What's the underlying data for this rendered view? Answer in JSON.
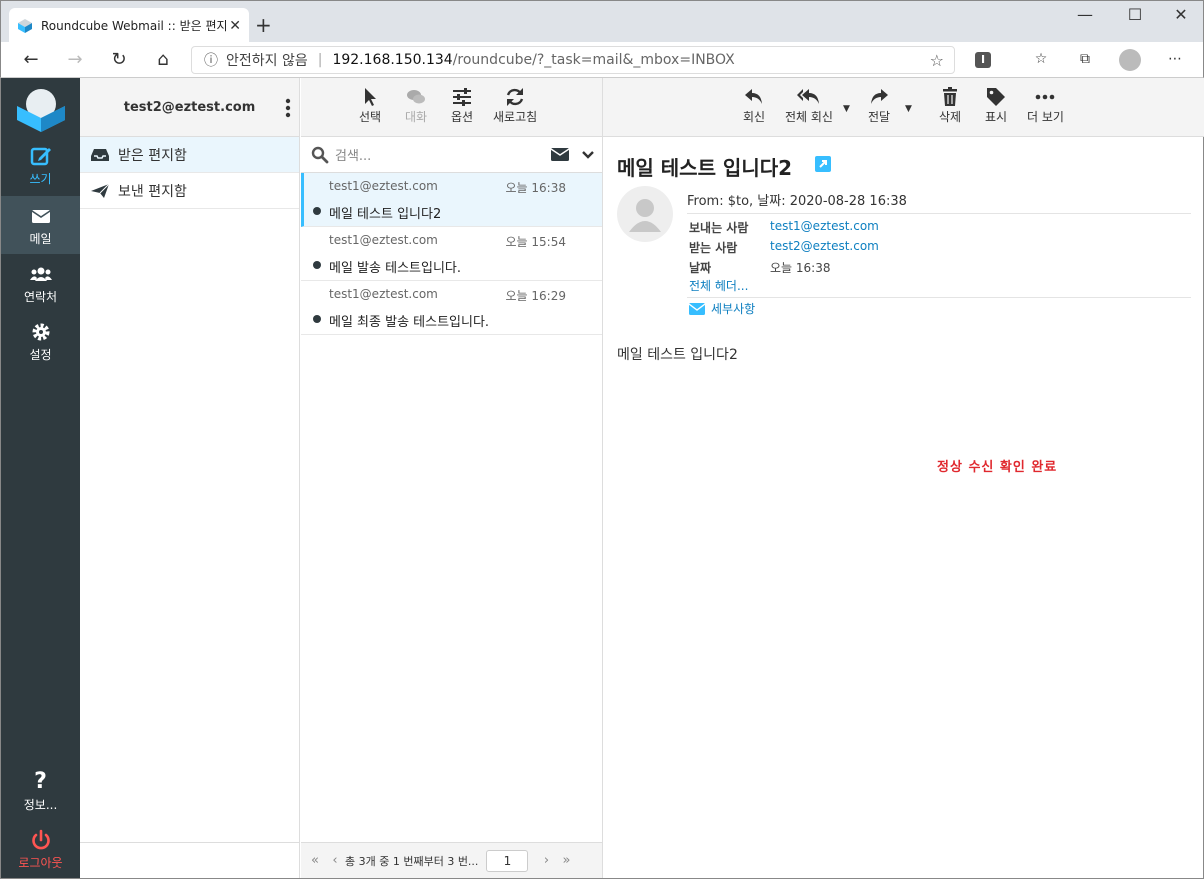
{
  "browser": {
    "tab_title": "Roundcube Webmail :: 받은 편지함",
    "url_warning": "안전하지 않음",
    "url_host": "192.168.150.134",
    "url_path": "/roundcube/?_task=mail&_mbox=INBOX",
    "new_tab": "+",
    "close": "✕"
  },
  "nav": {
    "compose": "쓰기",
    "mail": "메일",
    "contacts": "연락처",
    "settings": "설정",
    "about": "정보...",
    "logout": "로그아웃"
  },
  "folders": {
    "account": "test2@eztest.com",
    "items": [
      {
        "label": "받은 편지함"
      },
      {
        "label": "보낸 편지함"
      }
    ]
  },
  "list_toolbar": {
    "select": "선택",
    "threads": "대화",
    "options": "옵션",
    "refresh": "새로고침"
  },
  "search": {
    "placeholder": "검색..."
  },
  "messages": [
    {
      "from": "test1@eztest.com",
      "date": "오늘 16:38",
      "subject": "메일 테스트 입니다2"
    },
    {
      "from": "test1@eztest.com",
      "date": "오늘 15:54",
      "subject": "메일 발송 테스트입니다."
    },
    {
      "from": "test1@eztest.com",
      "date": "오늘 16:29",
      "subject": "메일 최종 발송 테스트입니다."
    }
  ],
  "pagination": {
    "text": "총 3개 중 1 번째부터 3 번...",
    "page": "1"
  },
  "reader_toolbar": {
    "reply": "회신",
    "reply_all": "전체 회신",
    "forward": "전달",
    "delete": "삭제",
    "mark": "표시",
    "more": "더 보기"
  },
  "message": {
    "subject": "메일 테스트 입니다2",
    "from_line": "From: $to, 날짜: 2020-08-28 16:38",
    "sender_label": "보내는 사람",
    "sender": "test1@eztest.com",
    "recipient_label": "받는 사람",
    "recipient": "test2@eztest.com",
    "date_label": "날짜",
    "date": "오늘 16:38",
    "all_headers": "전체 헤더...",
    "details": "세부사항",
    "body": "메일 테스트 입니다2",
    "annotation": "정상 수신 확인 완료"
  },
  "colors": {
    "sidebar": "#2f3a3f",
    "accent": "#37beff",
    "logout": "#ff5552",
    "annotation": "#e0282e"
  }
}
